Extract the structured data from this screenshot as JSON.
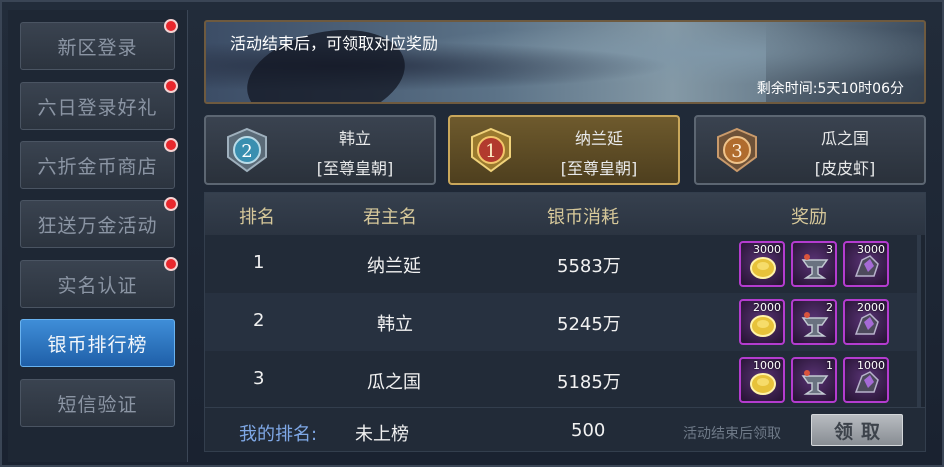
{
  "sidebar": {
    "items": [
      {
        "label": "新区登录",
        "has_dot": true,
        "active": false
      },
      {
        "label": "六日登录好礼",
        "has_dot": true,
        "active": false
      },
      {
        "label": "六折金币商店",
        "has_dot": true,
        "active": false
      },
      {
        "label": "狂送万金活动",
        "has_dot": true,
        "active": false
      },
      {
        "label": "实名认证",
        "has_dot": true,
        "active": false
      },
      {
        "label": "银币排行榜",
        "has_dot": false,
        "active": true
      },
      {
        "label": "短信验证",
        "has_dot": false,
        "active": false
      }
    ]
  },
  "banner": {
    "text": "活动结束后，可领取对应奖励",
    "timer": "剩余时间:5天10时06分"
  },
  "podium": [
    {
      "rank": "2",
      "name": "韩立",
      "guild": "[至尊皇朝]"
    },
    {
      "rank": "1",
      "name": "纳兰延",
      "guild": "[至尊皇朝]"
    },
    {
      "rank": "3",
      "name": "瓜之国",
      "guild": "[皮皮虾]"
    }
  ],
  "table": {
    "headers": {
      "rank": "排名",
      "lord": "君主名",
      "cost": "银币消耗",
      "reward": "奖励"
    },
    "rows": [
      {
        "rank": "1",
        "lord": "纳兰延",
        "cost": "5583万",
        "rewards": [
          "3000",
          "3",
          "3000"
        ]
      },
      {
        "rank": "2",
        "lord": "韩立",
        "cost": "5245万",
        "rewards": [
          "2000",
          "2",
          "2000"
        ]
      },
      {
        "rank": "3",
        "lord": "瓜之国",
        "cost": "5185万",
        "rewards": [
          "1000",
          "1",
          "1000"
        ]
      }
    ],
    "reward_icons": [
      "gold-coin-icon",
      "anvil-icon",
      "crystal-ore-icon"
    ]
  },
  "my_rank": {
    "label": "我的排名:",
    "value": "未上榜",
    "cost": "500",
    "note": "活动结束后领取",
    "claim_label": "领取"
  },
  "colors": {
    "accent_blue": "#3f8ed8",
    "header_gold": "#d6c89a",
    "my_label_blue": "#7fa8e6",
    "dot_red": "#e8272d",
    "reward_border_purple": "#b43ccf"
  }
}
